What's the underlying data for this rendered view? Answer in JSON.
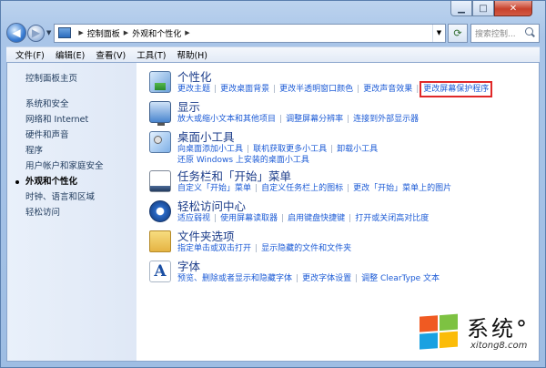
{
  "window": {
    "caption": {
      "minimize": "▁",
      "maximize": "□",
      "close": "✕"
    },
    "breadcrumb": [
      "控制面板",
      "外观和个性化"
    ],
    "search_placeholder": "搜索控制..."
  },
  "menubar": {
    "items": [
      {
        "label": "文件(F)"
      },
      {
        "label": "编辑(E)"
      },
      {
        "label": "查看(V)"
      },
      {
        "label": "工具(T)"
      },
      {
        "label": "帮助(H)"
      }
    ]
  },
  "sidebar": {
    "home": "控制面板主页",
    "items": [
      {
        "label": "系统和安全"
      },
      {
        "label": "网络和 Internet"
      },
      {
        "label": "硬件和声音"
      },
      {
        "label": "程序"
      },
      {
        "label": "用户帐户和家庭安全"
      },
      {
        "label": "外观和个性化",
        "current": true
      },
      {
        "label": "时钟、语言和区域"
      },
      {
        "label": "轻松访问"
      }
    ]
  },
  "categories": [
    {
      "title": "个性化",
      "icon": "personalization-icon",
      "links": [
        "更改主题",
        "更改桌面背景",
        "更改半透明窗口颜色",
        "更改声音效果",
        "更改屏幕保护程序"
      ],
      "highlighted_index": 4
    },
    {
      "title": "显示",
      "icon": "display-icon",
      "links": [
        "放大或缩小文本和其他项目",
        "调整屏幕分辨率",
        "连接到外部显示器"
      ]
    },
    {
      "title": "桌面小工具",
      "icon": "desktop-gadgets-icon",
      "links": [
        "向桌面添加小工具",
        "联机获取更多小工具",
        "卸载小工具",
        "还原 Windows 上安装的桌面小工具"
      ],
      "break_before": 3
    },
    {
      "title": "任务栏和「开始」菜单",
      "icon": "taskbar-icon",
      "links": [
        "自定义「开始」菜单",
        "自定义任务栏上的图标",
        "更改「开始」菜单上的图片"
      ]
    },
    {
      "title": "轻松访问中心",
      "icon": "ease-of-access-icon",
      "links": [
        "适应弱视",
        "使用屏幕读取器",
        "启用键盘快捷键",
        "打开或关闭高对比度"
      ]
    },
    {
      "title": "文件夹选项",
      "icon": "folder-options-icon",
      "links": [
        "指定单击或双击打开",
        "显示隐藏的文件和文件夹"
      ]
    },
    {
      "title": "字体",
      "icon": "fonts-icon",
      "links": [
        "预览、删除或者显示和隐藏字体",
        "更改字体设置",
        "调整 ClearType 文本"
      ]
    }
  ],
  "watermark": {
    "title": "系统°",
    "url": "xitong8.com"
  },
  "colors": {
    "link": "#1c5bd6",
    "title": "#1c3d8a",
    "highlight_box": "#e02828"
  }
}
